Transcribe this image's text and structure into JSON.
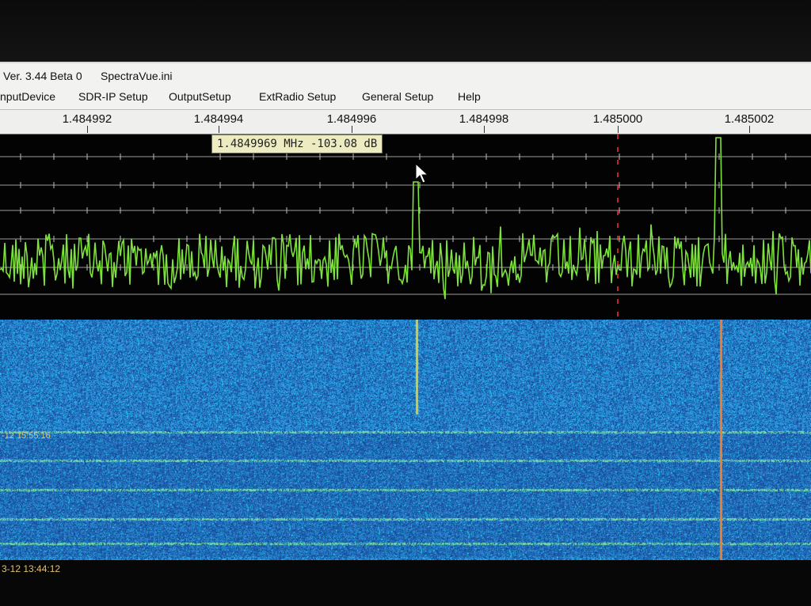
{
  "title_bar": {
    "version": "Ver. 3.44 Beta 0",
    "config_file": "SpectraVue.ini"
  },
  "menu": {
    "items": [
      {
        "label": "nputDevice",
        "name": "menu-input-device"
      },
      {
        "label": "SDR-IP Setup",
        "name": "menu-sdr-ip-setup"
      },
      {
        "label": "OutputSetup",
        "name": "menu-output-setup"
      },
      {
        "label": "ExtRadio Setup",
        "name": "menu-extradio-setup"
      },
      {
        "label": "General Setup",
        "name": "menu-general-setup"
      },
      {
        "label": "Help",
        "name": "menu-help"
      }
    ]
  },
  "frequency_axis": {
    "labels": [
      "1.484992",
      "1.484994",
      "1.484996",
      "1.484998",
      "1.485000",
      "1.485002"
    ]
  },
  "cursor_readout": {
    "text": "1.4849969 MHz -103.08 dB"
  },
  "waterfall": {
    "timestamps": [
      "-12 15:55:16",
      "3-12 13:44:12"
    ]
  },
  "colors": {
    "trace": "#7de33a",
    "grid": "#cfcfcf",
    "marker": "#ff3030",
    "waterfall_base": "#1a4fb0"
  }
}
